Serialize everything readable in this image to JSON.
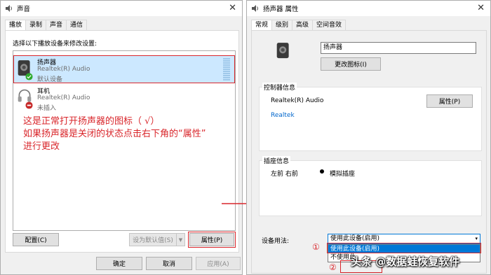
{
  "sound_dialog": {
    "title": "声音",
    "tabs": [
      "播放",
      "录制",
      "声音",
      "通信"
    ],
    "instruction": "选择以下播放设备来修改设置:",
    "devices": [
      {
        "name": "扬声器",
        "driver": "Realtek(R) Audio",
        "status": "默认设备"
      },
      {
        "name": "耳机",
        "driver": "Realtek(R) Audio",
        "status": "未插入"
      }
    ],
    "buttons": {
      "configure": "配置(C)",
      "set_default": "设为默认值(S)",
      "properties": "属性(P)",
      "ok": "确定",
      "cancel": "取消",
      "apply": "应用(A)"
    }
  },
  "annotation": {
    "lines": [
      "这是正常打开扬声器的图标（ √）",
      "如果扬声器是关闭的状态点击右下角的“属性”",
      "进行更改"
    ]
  },
  "props_dialog": {
    "title": "扬声器 属性",
    "tabs": [
      "常规",
      "级别",
      "高级",
      "空间音效"
    ],
    "device_name": "扬声器",
    "change_icon": "更改图标(I)",
    "controller_info_label": "控制器信息",
    "controller_name": "Realtek(R) Audio",
    "controller_properties": "属性(P)",
    "controller_vendor_link": "Realtek",
    "jack_info_label": "插座信息",
    "jack_position": "左前 右前",
    "jack_type": "模拟插座",
    "usage_label": "设备用法:",
    "usage_selected": "使用此设备(启用)",
    "usage_options": [
      "使用此设备(启用)",
      "不使用此"
    ],
    "markers": [
      "①",
      "②"
    ]
  },
  "watermark": "头条 @数据蛙恢复软件",
  "colors": {
    "annotation_red": "#d9262b",
    "selection_blue": "#cce8ff",
    "dropdown_highlight": "#0078d7",
    "link_blue": "#0066cc",
    "check_green": "#2eaa2e"
  }
}
